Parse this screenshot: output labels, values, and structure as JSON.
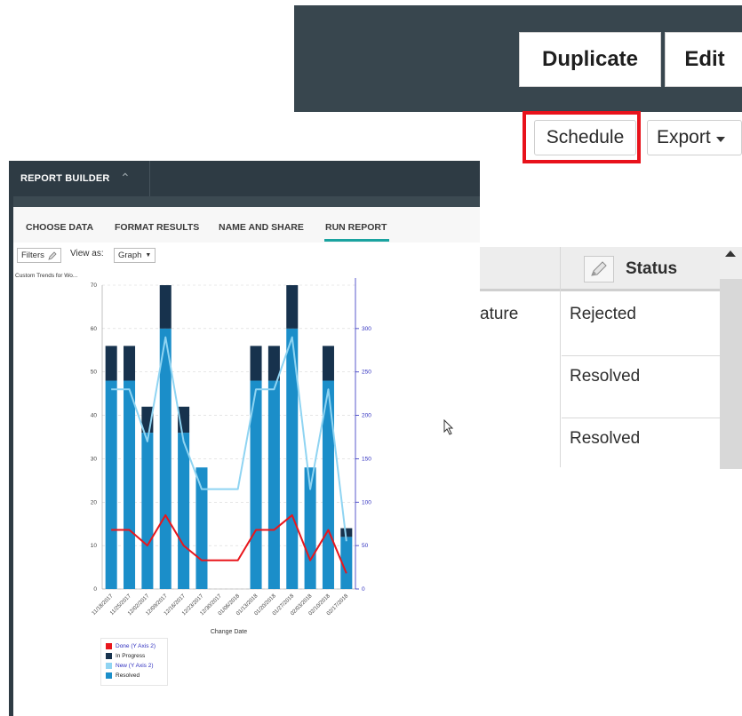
{
  "toolbar": {
    "duplicate_label": "Duplicate",
    "edit_label": "Edit"
  },
  "actions": {
    "schedule_label": "Schedule",
    "export_label": "Export"
  },
  "table": {
    "status_header": "Status",
    "partial_cell": "ature",
    "rows": [
      {
        "status": "Rejected"
      },
      {
        "status": "Resolved"
      },
      {
        "status": "Resolved"
      }
    ]
  },
  "report_builder": {
    "title": "REPORT BUILDER",
    "tabs": [
      "CHOOSE DATA",
      "FORMAT RESULTS",
      "NAME AND SHARE",
      "RUN REPORT"
    ],
    "active_tab": "RUN REPORT",
    "filters_label": "Filters",
    "view_as_label": "View as:",
    "view_as_value": "Graph"
  },
  "colors": {
    "done": "#e8161c",
    "in_progress": "#17324d",
    "new": "#8fd4f2",
    "resolved": "#1b8ec9",
    "right_axis": "#2f2fbf"
  },
  "chart_data": {
    "type": "bar",
    "title": "Custom Trends for Wo...",
    "xlabel": "Change Date",
    "categories": [
      "11/18/2017",
      "11/25/2017",
      "12/02/2017",
      "12/09/2017",
      "12/16/2017",
      "12/23/2017",
      "12/30/2017",
      "01/06/2018",
      "01/13/2018",
      "01/20/2018",
      "01/27/2018",
      "02/03/2018",
      "02/10/2018",
      "02/17/2018"
    ],
    "ylim": [
      0,
      70
    ],
    "yticks": [
      0,
      10,
      20,
      30,
      40,
      50,
      60,
      70
    ],
    "y2lim": [
      0,
      350
    ],
    "y2ticks": [
      0,
      50,
      100,
      150,
      200,
      250,
      300
    ],
    "stacked": true,
    "series": [
      {
        "name": "Resolved",
        "axis": "left",
        "kind": "bar",
        "values": [
          48,
          48,
          36,
          60,
          36,
          28,
          0,
          0,
          48,
          48,
          60,
          28,
          48,
          12
        ]
      },
      {
        "name": "In Progress",
        "axis": "left",
        "kind": "bar",
        "values": [
          8,
          8,
          6,
          10,
          6,
          0,
          0,
          0,
          8,
          8,
          10,
          0,
          8,
          2
        ]
      },
      {
        "name": "New (Y Axis 2)",
        "axis": "right",
        "kind": "line",
        "values": [
          230,
          230,
          170,
          290,
          170,
          115,
          115,
          115,
          230,
          230,
          290,
          115,
          230,
          55
        ]
      },
      {
        "name": "Done (Y Axis 2)",
        "axis": "right",
        "kind": "line",
        "values": [
          68,
          68,
          50,
          85,
          50,
          33,
          33,
          33,
          68,
          68,
          85,
          33,
          68,
          18
        ]
      }
    ],
    "legend": [
      "Done (Y Axis 2)",
      "In Progress",
      "New (Y Axis 2)",
      "Resolved"
    ],
    "legend_position": "bottom-left"
  }
}
